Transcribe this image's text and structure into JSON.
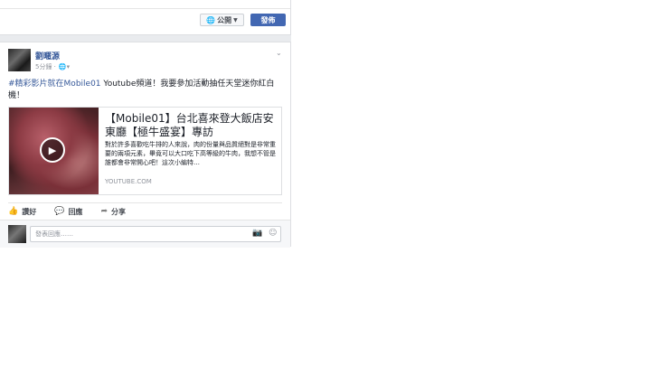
{
  "composer": {
    "privacy_label": "公開",
    "post_label": "發佈"
  },
  "post": {
    "author": "劉暱源",
    "time": "5分鐘 ·",
    "text_tag": "#精彩影片就在Mobile01",
    "text_body": " Youtube頻道！我要參加活動抽任天堂迷你紅白機！",
    "link": {
      "title": "【Mobile01】台北喜來登大飯店安東廳【極牛盛宴】專訪",
      "description": "對於許多喜歡吃牛排的人來說，肉的份量與品質絕對是非常重要的兩項元素，畢竟可以大口吃下高等級的牛肉，我想不管是誰都會非常開心吧！這次小編特…",
      "domain": "YOUTUBE.COM"
    },
    "actions": {
      "like": "讚好",
      "comment": "回應",
      "share": "分享"
    },
    "comment_placeholder": "發表回應……"
  },
  "icons": {
    "privacy": "globe-icon",
    "post_menu": "chevron-down-icon",
    "play": "play-icon",
    "like": "thumbs-up-icon",
    "comment": "comment-icon",
    "share": "share-icon",
    "camera": "camera-icon",
    "emoji": "emoji-icon"
  },
  "colors": {
    "brand": "#4267b2",
    "link": "#365899",
    "feed_bg": "#e9ebee"
  }
}
